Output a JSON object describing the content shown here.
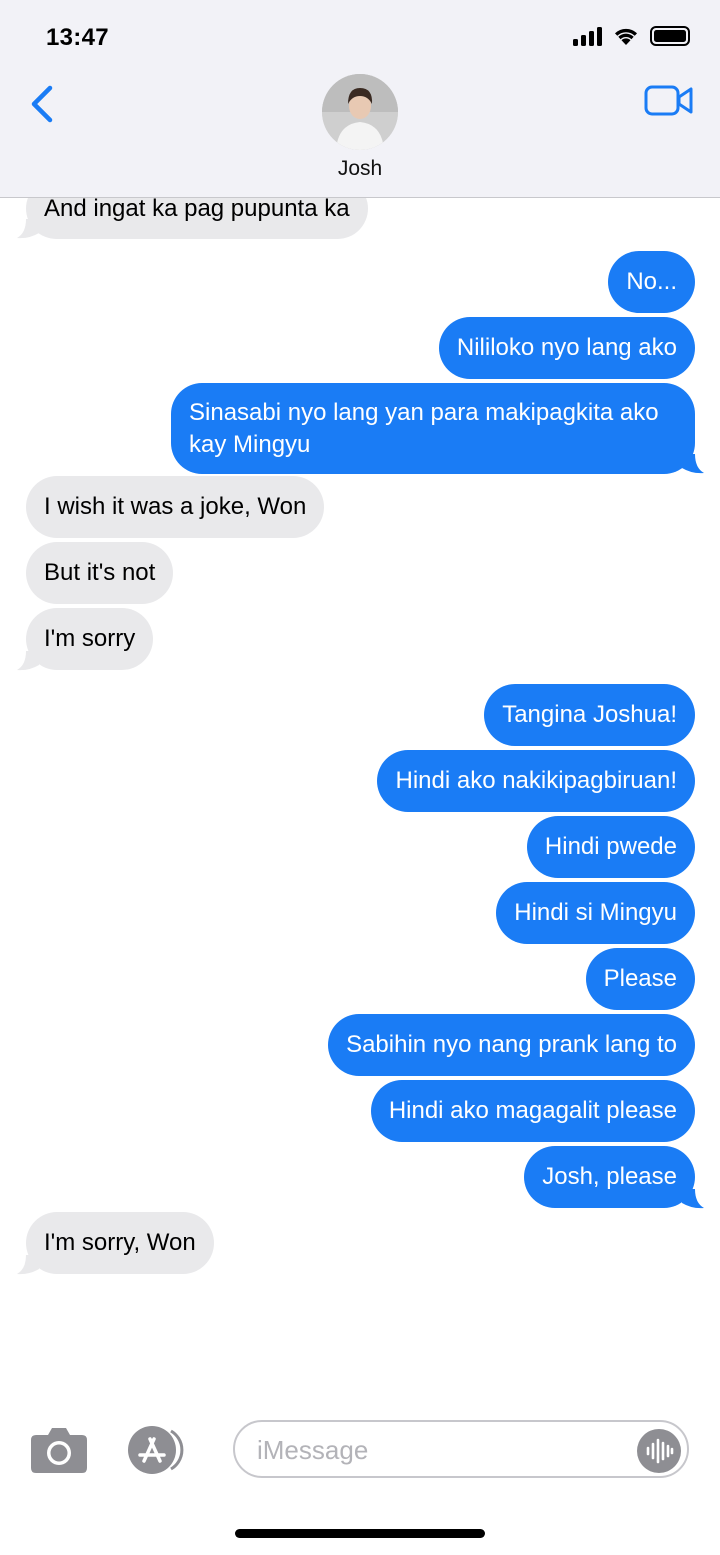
{
  "status_bar": {
    "time": "13:47",
    "battery_level": 1.0
  },
  "header": {
    "contact_name": "Josh",
    "back_icon": "chevron-left-icon",
    "video_icon": "video-camera-icon",
    "accent_color": "#1a7cf5"
  },
  "messages": [
    {
      "direction": "in",
      "text": "And ingat ka pag pupunta ka"
    },
    {
      "direction": "out",
      "text": "No..."
    },
    {
      "direction": "out",
      "text": "Nililoko nyo lang ako"
    },
    {
      "direction": "out",
      "text": "Sinasabi nyo lang yan para makipagkita ako kay Mingyu"
    },
    {
      "direction": "in",
      "text": "I wish it was a joke, Won"
    },
    {
      "direction": "in",
      "text": "But it's not"
    },
    {
      "direction": "in",
      "text": "I'm sorry"
    },
    {
      "direction": "out",
      "text": "Tangina Joshua!"
    },
    {
      "direction": "out",
      "text": "Hindi ako nakikipagbiruan!"
    },
    {
      "direction": "out",
      "text": "Hindi pwede"
    },
    {
      "direction": "out",
      "text": "Hindi si Mingyu"
    },
    {
      "direction": "out",
      "text": "Please"
    },
    {
      "direction": "out",
      "text": "Sabihin nyo nang prank lang to"
    },
    {
      "direction": "out",
      "text": "Hindi ako magagalit please"
    },
    {
      "direction": "out",
      "text": "Josh, please"
    },
    {
      "direction": "in",
      "text": "I'm sorry, Won"
    }
  ],
  "colors": {
    "outgoing_bubble": "#1a7cf5",
    "incoming_bubble": "#e9e9eb"
  },
  "composer": {
    "placeholder": "iMessage",
    "camera_icon": "camera-icon",
    "apps_icon": "app-store-icon",
    "audio_icon": "audio-waveform-icon"
  }
}
